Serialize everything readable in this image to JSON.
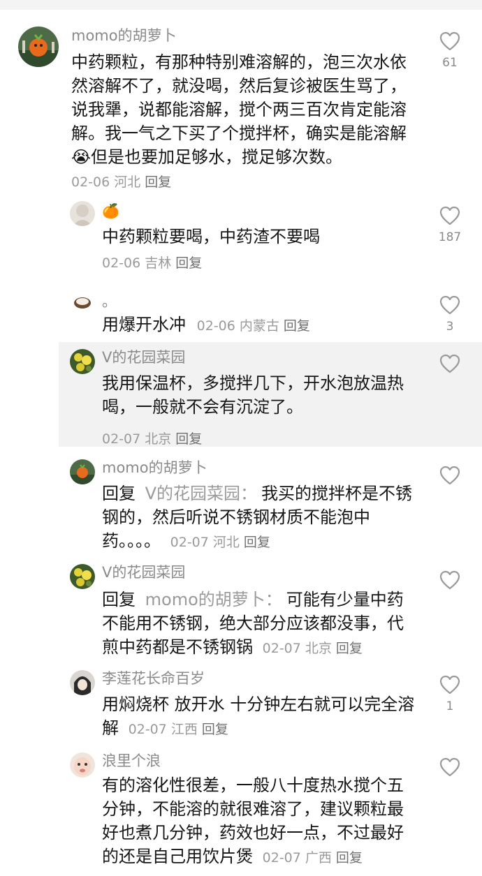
{
  "comments": [
    {
      "author": "momo的胡萝卜",
      "text": "中药颗粒，有那种特别难溶解的，泡三次水依然溶解不了，就没喝，然后复诊被医生骂了，说我犟，说都能溶解，搅个两三百次肯定能溶解。我一气之下买了个搅拌杯，确实是能溶解😭但是也要加足够水，搅足够次数。",
      "date": "02-06",
      "location": "河北",
      "reply_label": "回复",
      "likes": "61"
    },
    {
      "author": "🍊",
      "text": "中药颗粒要喝，中药渣不要喝",
      "date": "02-06",
      "location": "吉林",
      "reply_label": "回复",
      "likes": "187"
    },
    {
      "author": "。",
      "text": "用爆开水冲",
      "date": "02-06",
      "location": "内蒙古",
      "reply_label": "回复",
      "likes": "3"
    },
    {
      "author": "V的花园菜园",
      "text": "我用保温杯，多搅拌几下，开水泡放温热喝，一般就不会有沉淀了。",
      "date": "02-07",
      "location": "北京",
      "reply_label": "回复",
      "likes": ""
    },
    {
      "author": "momo的胡萝卜",
      "reply_prefix": "回复",
      "reply_to": "V的花园菜园：",
      "text": "我买的搅拌杯是不锈钢的，然后听说不锈钢材质不能泡中药。。。。",
      "date": "02-07",
      "location": "河北",
      "reply_label": "回复",
      "likes": ""
    },
    {
      "author": "V的花园菜园",
      "reply_prefix": "回复",
      "reply_to": "momo的胡萝卜：",
      "text": "可能有少量中药不能用不锈钢，绝大部分应该都没事，代煎中药都是不锈钢锅",
      "date": "02-07",
      "location": "北京",
      "reply_label": "回复",
      "likes": ""
    },
    {
      "author": "李莲花长命百岁",
      "text": "用焖烧杯 放开水 十分钟左右就可以完全溶解",
      "date": "02-07",
      "location": "江西",
      "reply_label": "回复",
      "likes": "1"
    },
    {
      "author": "浪里个浪",
      "text": "有的溶化性很差，一般八十度热水搅个五分钟，不能溶的就很难溶了，建议颗粒最好也煮几分钟，药效也好一点，不过最好的还是自己用饮片煲",
      "date": "02-07",
      "location": "广西",
      "reply_label": "回复",
      "likes": ""
    }
  ],
  "icons": {
    "like": "heart-outline-icon"
  },
  "colors": {
    "name": "#8a8a8a",
    "meta": "#9a9a9a",
    "highlight": "#f2f2f2"
  }
}
